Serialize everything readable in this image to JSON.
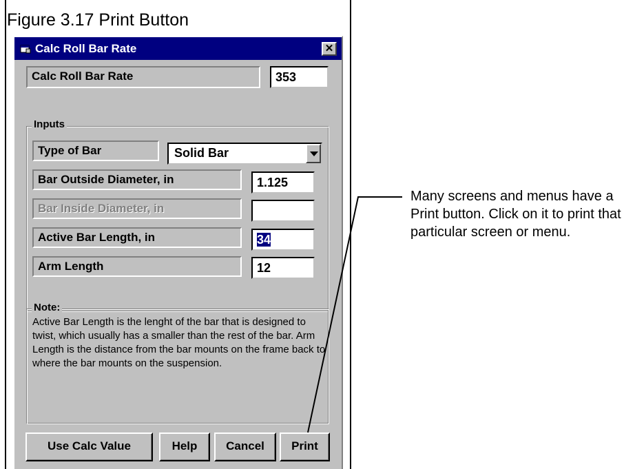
{
  "figure": {
    "caption": "Figure 3.17  Print Button"
  },
  "window": {
    "title": "Calc Roll Bar Rate",
    "close_glyph": "✕",
    "icon": "window-app-icon"
  },
  "result": {
    "label": "Calc Roll Bar Rate",
    "value": "353"
  },
  "inputs": {
    "legend": "Inputs",
    "type_of_bar": {
      "label": "Type of Bar",
      "selected": "Solid Bar"
    },
    "outside_diameter": {
      "label": "Bar Outside Diameter, in",
      "value": "1.125"
    },
    "inside_diameter": {
      "label": "Bar Inside Diameter, in",
      "value": ""
    },
    "active_length": {
      "label": "Active Bar Length, in",
      "value": "34"
    },
    "arm_length": {
      "label": "Arm Length",
      "value": "12"
    }
  },
  "note": {
    "legend": "Note:",
    "text": "Active Bar Length is the lenght of the bar that is designed to twist, which usually has a smaller than the rest of the bar.  Arm Length is the distance from the bar mounts on the frame back to where the bar mounts on the suspension."
  },
  "buttons": {
    "use_calc": "Use Calc Value",
    "help": "Help",
    "cancel": "Cancel",
    "print": "Print"
  },
  "callout": {
    "text": "Many screens and menus have a Print button.  Click on it to print that particular screen or menu."
  },
  "colors": {
    "titlebar": "#000080",
    "dialog_face": "#c0c0c0"
  }
}
